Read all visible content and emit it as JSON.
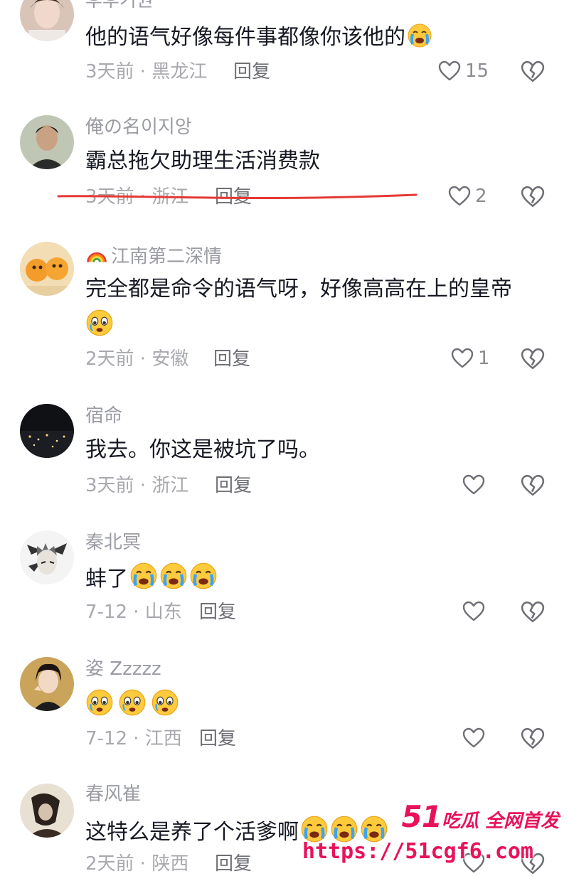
{
  "comments": [
    {
      "username": "후후기원",
      "text": "他的语气好像每件事都像你该他的",
      "emoji_after": [
        "crying"
      ],
      "time_location": "3天前 · 黑龙江",
      "reply_label": "回复",
      "likes": "15"
    },
    {
      "username": "俺の名이지앙",
      "text": "霸总拖欠助理生活消费款",
      "time_location": "3天前 · 浙江",
      "reply_label": "回复",
      "likes": "2"
    },
    {
      "username": "江南第二深情",
      "username_prefix_icon": "rainbow",
      "text": "完全都是命令的语气呀，好像高高在上的皇帝",
      "time_location": "2天前 · 安徽",
      "reply_label": "回复",
      "likes": "1"
    },
    {
      "username": "宿命",
      "text": "我去。你这是被坑了吗。",
      "time_location": "3天前 · 浙江",
      "reply_label": "回复",
      "likes": ""
    },
    {
      "username": "秦北冥",
      "text": "蚌了",
      "time_location": "7-12 · 山东",
      "reply_label": "回复",
      "likes": ""
    },
    {
      "username": "姿 Zzzzz",
      "text": "",
      "time_location": "7-12 · 江西",
      "reply_label": "回复",
      "likes": ""
    },
    {
      "username": "春风崔",
      "text": "这特么是养了个活爹啊",
      "time_location": "2天前 · 陕西",
      "reply_label": "回复",
      "likes": ""
    }
  ],
  "watermark": {
    "brand_number": "51",
    "brand_text": "吃瓜 全网首发",
    "url": "https://51cgf6.com"
  },
  "colors": {
    "text": "#161823",
    "muted": "#a8a9ae",
    "strike": "#e53935",
    "watermark": "#e8125a"
  }
}
